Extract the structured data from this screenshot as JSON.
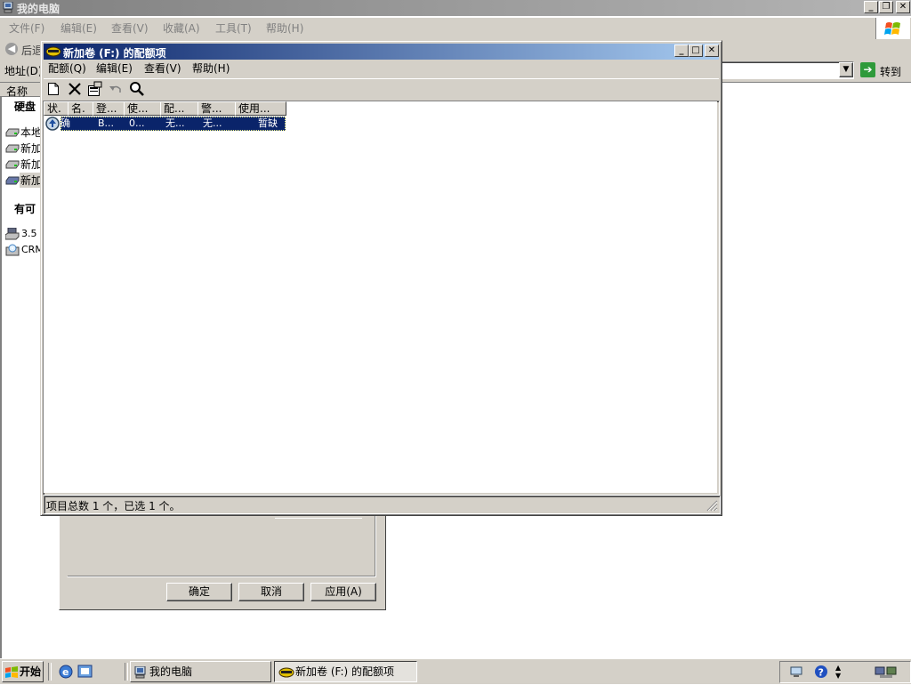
{
  "explorer": {
    "title": "我的电脑",
    "menu": [
      "文件(F)",
      "编辑(E)",
      "查看(V)",
      "收藏(A)",
      "工具(T)",
      "帮助(H)"
    ],
    "back_label": "后退",
    "address_label": "地址(D)",
    "go_label": "转到",
    "column_name": "名称",
    "section_disks": "硬盘",
    "disks": [
      "本地",
      "新加",
      "新加",
      "新加"
    ],
    "section_removable": "有可",
    "removable": [
      "3.5",
      "CRM"
    ]
  },
  "properties_dialog": {
    "ok_label": "确定",
    "cancel_label": "取消",
    "apply_label": "应用(A)"
  },
  "quota_window": {
    "title": "新加卷 (F:) 的配额项",
    "menu": [
      "配额(Q)",
      "编辑(E)",
      "查看(V)",
      "帮助(H)"
    ],
    "columns": [
      "状.",
      "名.",
      "登...",
      "使...",
      "配...",
      "警...",
      "使用..."
    ],
    "rows": [
      {
        "status": "确",
        "name": "",
        "logon": "B...",
        "used": "0...",
        "limit": "无...",
        "warning": "无...",
        "percent": "暂缺"
      }
    ],
    "status_text": "项目总数 1 个，已选 1 个。"
  },
  "taskbar": {
    "start_label": "开始",
    "tasks": [
      "我的电脑",
      "新加卷 (F:) 的配额项"
    ]
  }
}
